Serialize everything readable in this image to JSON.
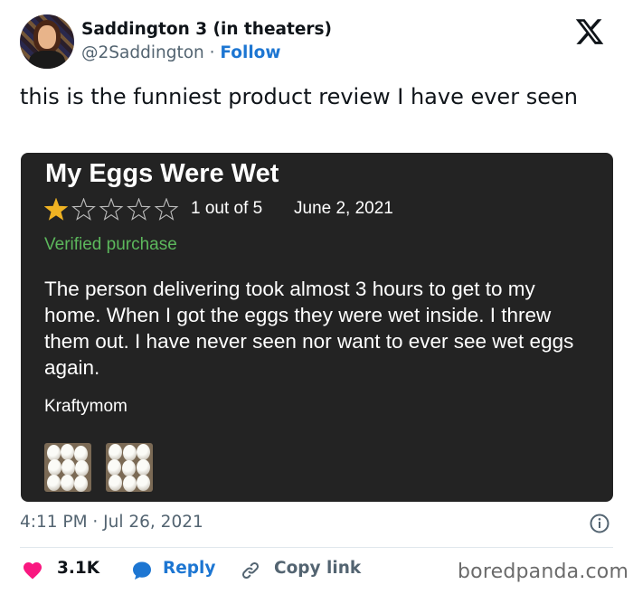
{
  "tweet": {
    "display_name": "Saddington 3 (in theaters)",
    "handle": "@2Saddington",
    "separator": " · ",
    "follow_label": "Follow",
    "text": "this is the funniest product review I have ever seen",
    "timestamp": "4:11 PM · Jul 26, 2021",
    "logo_icon": "x-logo-icon"
  },
  "review": {
    "title": "My Eggs Were Wet",
    "rating_value": 1,
    "rating_max": 5,
    "rating_text": "1 out of 5",
    "date": "June 2, 2021",
    "verified": "Verified purchase",
    "body": "The person delivering took almost 3 hours to get to my home. When I got the eggs they were wet inside. I threw them out. I have never seen nor want to ever see wet eggs again.",
    "author": "Kraftymom",
    "photo_count": 2
  },
  "actions": {
    "likes": "3.1K",
    "reply_label": "Reply",
    "copy_label": "Copy link"
  },
  "watermark": "boredpanda.com",
  "colors": {
    "follow": "#1d76d2",
    "heart": "#f91880",
    "verified": "#5cb85c",
    "star": "#f0b323",
    "card_bg": "#232323"
  }
}
